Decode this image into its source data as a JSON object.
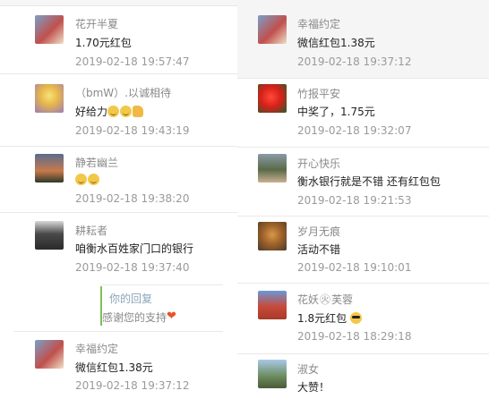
{
  "left_comments": [
    {
      "name": "花开半夏",
      "message": "1.70元红包",
      "time": "2019-02-18 19:57:47",
      "emojis": []
    },
    {
      "name": "（bmW）.以诚相待",
      "message": "好给力",
      "time": "2019-02-18 19:43:19",
      "emojis": [
        "smile-emoji",
        "smile-emoji",
        "thumbs-up-emoji"
      ]
    },
    {
      "name": "静若幽兰",
      "message": "",
      "time": "2019-02-18 19:38:20",
      "emojis": [
        "smile-emoji",
        "smile-emoji"
      ]
    },
    {
      "name": "耕耘者",
      "message": "咱衡水百姓家门口的银行",
      "time": "2019-02-18 19:37:40",
      "emojis": []
    },
    {
      "name": "幸福约定",
      "message": "微信红包1.38元",
      "time": "2019-02-18 19:37:12",
      "emojis": []
    }
  ],
  "reply": {
    "title": "你的回复",
    "text": "感谢您的支持",
    "emoji": "heart-emoji"
  },
  "right_comments": [
    {
      "name": "幸福约定",
      "message": "微信红包1.38元",
      "time": "2019-02-18 19:37:12"
    },
    {
      "name": "竹报平安",
      "message": "中奖了，1.75元",
      "time": "2019-02-18 19:32:07"
    },
    {
      "name": "开心快乐",
      "message": "衡水银行就是不错 还有红包包",
      "time": "2019-02-18 19:21:53"
    },
    {
      "name": "岁月无痕",
      "message": "活动不错",
      "time": "2019-02-18 19:10:01"
    },
    {
      "name": "花妖",
      "name_suffix": "芙蓉",
      "message": "1.8元红包",
      "time": "2019-02-18 18:29:18"
    },
    {
      "name": "淑女",
      "message": "大赞！",
      "time": ""
    }
  ],
  "colors": {
    "accent_reply_bar": "#7fbf5a",
    "time_text": "#9a9a9a",
    "name_text": "#8a8a8a"
  }
}
